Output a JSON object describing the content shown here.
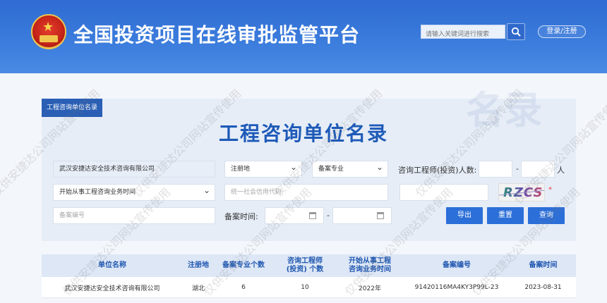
{
  "header": {
    "title": "全国投资项目在线审批监管平台",
    "search_placeholder": "请输入关键词进行搜索",
    "login_label": "登录/注册"
  },
  "panel": {
    "tag": "工程咨询单位名录",
    "title": "工程咨询单位名录",
    "bg_text": "名录"
  },
  "filters": {
    "unit_name": "武汉安捷达安全技术咨询有限公司",
    "region": "注册地",
    "specialty": "备案专业",
    "engineer_count_label": "咨询工程师(投资)人数:",
    "range_dash": "-",
    "person_unit": "人",
    "start_time": "开始从事工程咨询业务时间",
    "credit_code_placeholder": "统一社会信用代码",
    "filing_no_placeholder": "备案编号",
    "filing_time_label": "备案时间:",
    "captcha_text": "RZCS",
    "required_mark": "*"
  },
  "buttons": {
    "export": "导出",
    "reset": "重置",
    "query": "查询"
  },
  "table": {
    "headers": [
      "单位名称",
      "注册地",
      "备案专业个数",
      "咨询工程师\n(投资) 个数",
      "开始从事工程\n咨询业务时间",
      "备案编号",
      "备案时间"
    ],
    "rows": [
      [
        "武汉安捷达安全技术咨询有限公司",
        "湖北",
        "6",
        "10",
        "2022年",
        "91420116MA4KY3P99L-23",
        "2023-08-31"
      ]
    ]
  },
  "watermark": "仅供安捷达公司网站宣传使用",
  "colors": {
    "header_blue": "#3575d8",
    "primary_button": "#2c6fd8",
    "title_blue": "#1e5ab8"
  }
}
